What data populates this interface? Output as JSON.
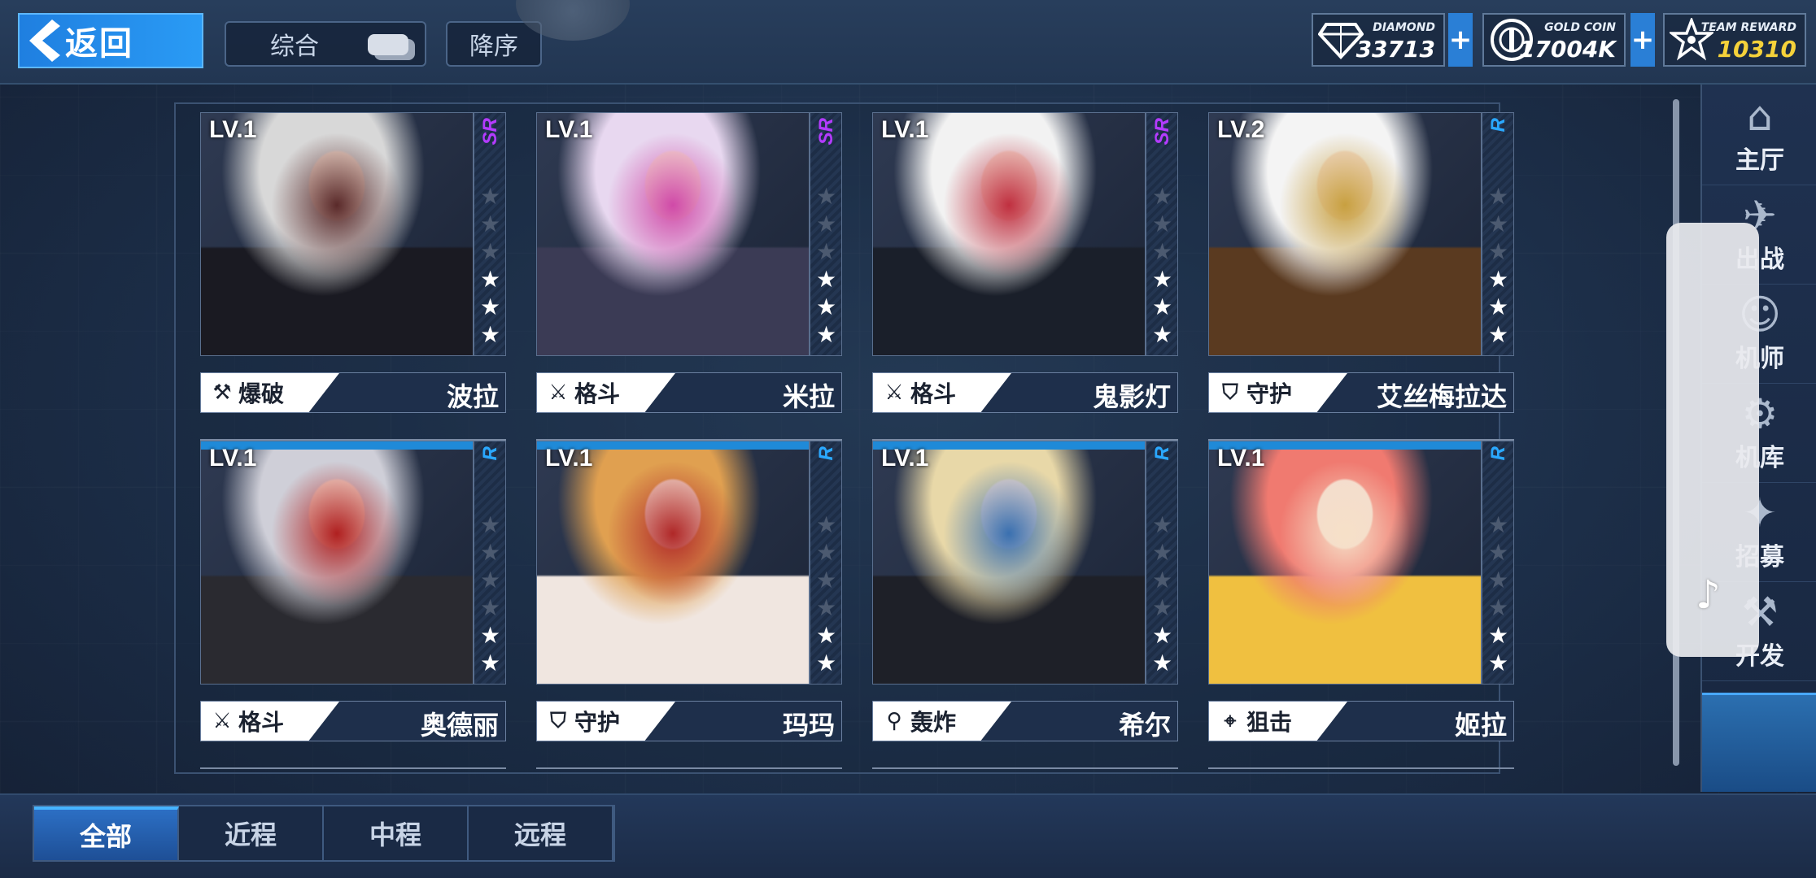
{
  "header": {
    "back_label": "返回",
    "sort_label": "综合",
    "order_label": "降序"
  },
  "resources": [
    {
      "name": "DIAMOND",
      "value": "33713",
      "icon": "diamond-icon"
    },
    {
      "name": "GOLD COIN",
      "value": "17004K",
      "icon": "coin-icon"
    },
    {
      "name": "TEAM REWARD",
      "value": "10310",
      "icon": "star-badge-icon"
    }
  ],
  "colors": {
    "accent": "#2a9bf5",
    "sr": "#b43bff",
    "r": "#2aa8ff",
    "reward": "#f5d23a"
  },
  "characters": [
    {
      "level": "LV.1",
      "rarity": "SR",
      "stars": 3,
      "role": "爆破",
      "role_icon": "explosive-icon",
      "name": "波拉",
      "palette": [
        "#d8d8d8",
        "#1a1a22",
        "#5a2a2a"
      ]
    },
    {
      "level": "LV.1",
      "rarity": "SR",
      "stars": 3,
      "role": "格斗",
      "role_icon": "swords-icon",
      "name": "米拉",
      "palette": [
        "#e8d8f0",
        "#3b3b55",
        "#d04aa8"
      ]
    },
    {
      "level": "LV.1",
      "rarity": "SR",
      "stars": 3,
      "role": "格斗",
      "role_icon": "swords-icon",
      "name": "鬼影灯",
      "palette": [
        "#f2f2f2",
        "#1a1f2a",
        "#c03040"
      ]
    },
    {
      "level": "LV.2",
      "rarity": "R",
      "stars": 3,
      "role": "守护",
      "role_icon": "shield-icon",
      "name": "艾丝梅拉达",
      "palette": [
        "#f4f4f4",
        "#5a3a20",
        "#c8a040"
      ]
    },
    {
      "level": "LV.1",
      "rarity": "R",
      "stars": 2,
      "role": "格斗",
      "role_icon": "swords-icon",
      "name": "奥德丽",
      "palette": [
        "#cfcfd8",
        "#2a2a30",
        "#b02020"
      ]
    },
    {
      "level": "LV.1",
      "rarity": "R",
      "stars": 2,
      "role": "守护",
      "role_icon": "shield-icon",
      "name": "玛玛",
      "palette": [
        "#e0a050",
        "#f0e6e0",
        "#b02828"
      ]
    },
    {
      "level": "LV.1",
      "rarity": "R",
      "stars": 2,
      "role": "轰炸",
      "role_icon": "mortar-icon",
      "name": "希尔",
      "palette": [
        "#e8d8a8",
        "#1e2028",
        "#3a70b0"
      ]
    },
    {
      "level": "LV.1",
      "rarity": "R",
      "stars": 2,
      "role": "狙击",
      "role_icon": "rifle-icon",
      "name": "姬拉",
      "palette": [
        "#f07a70",
        "#f0c040",
        "#f6e0c8"
      ]
    }
  ],
  "nav": [
    {
      "label": "主厅",
      "icon": "hall-icon"
    },
    {
      "label": "出战",
      "icon": "battle-icon"
    },
    {
      "label": "机师",
      "icon": "pilot-icon"
    },
    {
      "label": "机库",
      "icon": "hangar-icon"
    },
    {
      "label": "招募",
      "icon": "recruit-icon"
    },
    {
      "label": "开发",
      "icon": "develop-icon"
    }
  ],
  "tabs": [
    {
      "label": "全部",
      "active": true
    },
    {
      "label": "近程",
      "active": false
    },
    {
      "label": "中程",
      "active": false
    },
    {
      "label": "远程",
      "active": false
    }
  ]
}
